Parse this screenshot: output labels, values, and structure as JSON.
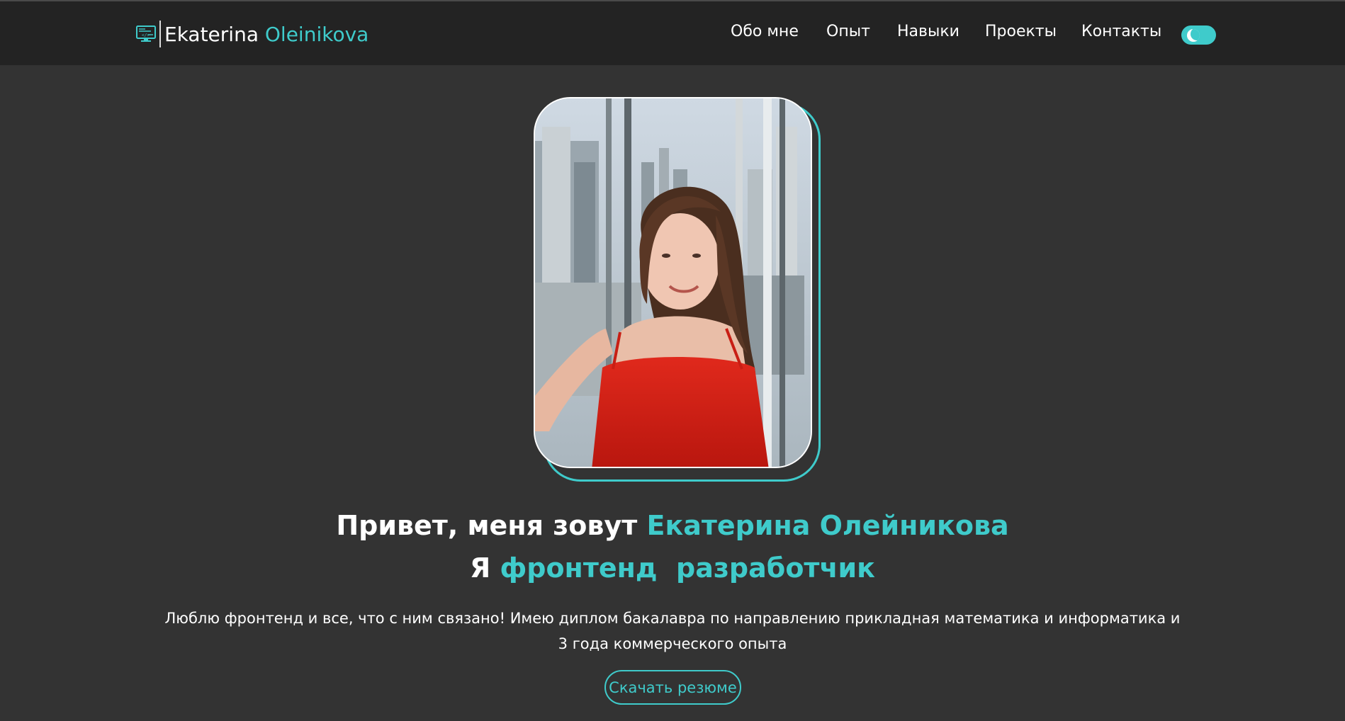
{
  "brand": {
    "first_name": "Ekaterina",
    "last_name": "Oleinikova",
    "icon": "code-monitor-icon"
  },
  "nav": {
    "items": [
      {
        "label": "Обо мне"
      },
      {
        "label": "Опыт"
      },
      {
        "label": "Навыки"
      },
      {
        "label": "Проекты"
      },
      {
        "label": "Контакты"
      }
    ],
    "theme_toggle": {
      "icon": "moon-icon",
      "state": "dark"
    }
  },
  "hero": {
    "greeting": "Привет, меня зовут",
    "name": "Екатерина Олейникова",
    "role_prefix": "Я",
    "role": "фронтенд  разработчик",
    "description": "Люблю фронтенд и все, что с ним связано! Имею диплом бакалавра по направлению прикладная математика и информатика и 3 года коммерческого опыта",
    "cv_button": "Скачать резюме"
  },
  "colors": {
    "accent": "#3fcbcb",
    "background": "#333333",
    "header": "#232323",
    "text": "#ffffff"
  }
}
